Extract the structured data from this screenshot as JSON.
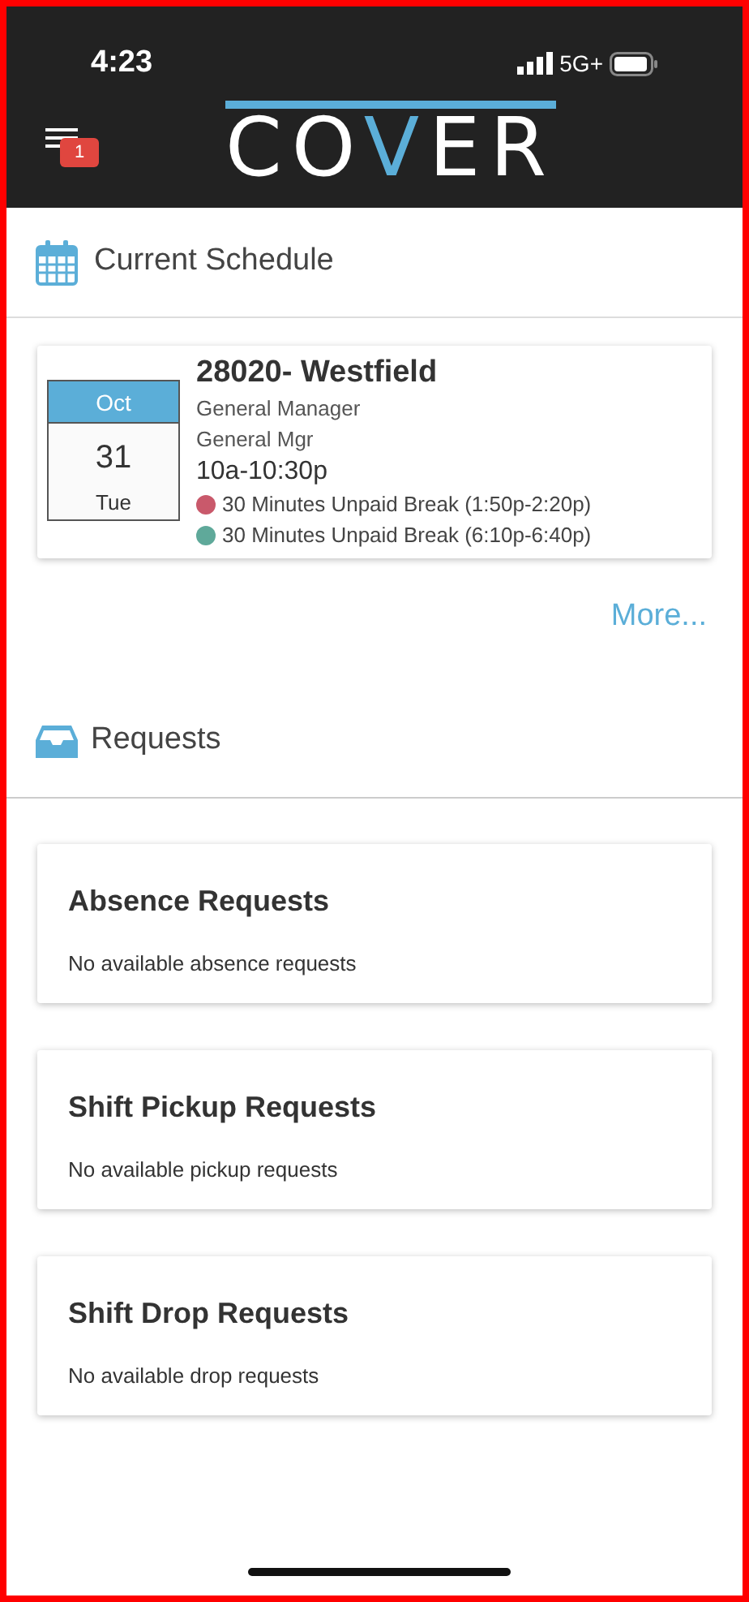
{
  "status_bar": {
    "time": "4:23",
    "network": "5G+"
  },
  "header": {
    "menu_badge": "1",
    "logo": [
      {
        "text": "CO",
        "accent": false
      },
      {
        "text": "V",
        "accent": true
      },
      {
        "text": "ER",
        "accent": false
      }
    ]
  },
  "schedule": {
    "title": "Current Schedule",
    "shift": {
      "month": "Oct",
      "day": "31",
      "weekday": "Tue",
      "location": "28020- Westfield",
      "position": "General Manager",
      "role": "General Mgr",
      "hours": "10a-10:30p",
      "breaks": [
        {
          "label": "30 Minutes Unpaid Break (1:50p-2:20p)",
          "color": "#c9596b"
        },
        {
          "label": "30 Minutes Unpaid Break (6:10p-6:40p)",
          "color": "#5fa99a"
        }
      ]
    },
    "more_link": "More..."
  },
  "requests": {
    "title": "Requests",
    "cards": [
      {
        "title": "Absence Requests",
        "message": "No available absence requests"
      },
      {
        "title": "Shift Pickup Requests",
        "message": "No available pickup requests"
      },
      {
        "title": "Shift Drop Requests",
        "message": "No available drop requests"
      }
    ]
  }
}
